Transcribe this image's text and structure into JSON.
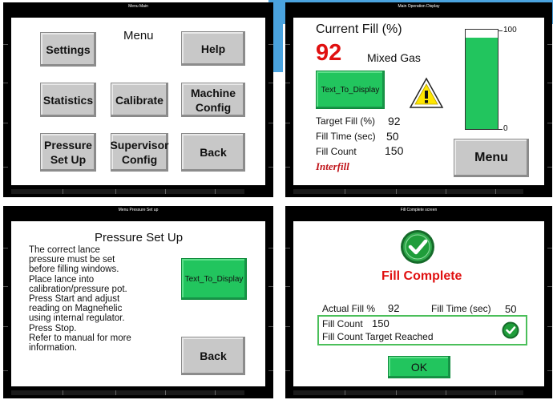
{
  "panels": {
    "menu_main": {
      "title": "Menu Main",
      "heading": "Menu",
      "buttons": {
        "settings": "Settings",
        "help": "Help",
        "statistics": "Statistics",
        "calibrate": "Calibrate",
        "machine_config": "Machine\nConfig",
        "pressure_setup": "Pressure\nSet Up",
        "supervisor_config": "Supervisor\nConfig",
        "back": "Back"
      }
    },
    "main_operation": {
      "title": "Main Operation Display",
      "current_fill_label": "Current Fill (%)",
      "current_fill_value": "92",
      "gas_type": "Mixed Gas",
      "status_button": "Text_To_Display",
      "warning_icon": "warning-triangle",
      "target_fill_label": "Target Fill (%)",
      "target_fill_value": "92",
      "fill_time_label": "Fill Time (sec)",
      "fill_time_value": "50",
      "fill_count_label": "Fill Count",
      "fill_count_value": "150",
      "logo_text": "Interfill",
      "bar_max_label": "100",
      "bar_min_label": "0",
      "bar_fill_percent": 92,
      "menu_button": "Menu"
    },
    "pressure_setup": {
      "title": "Menu Pressure Set up",
      "heading": "Pressure Set Up",
      "instructions": [
        "The correct lance",
        "pressure must be set",
        "before filling windows.",
        "Place lance into",
        "calibration/pressure pot.",
        "Press Start and adjust",
        "reading on Magnehelic",
        "using internal regulator.",
        "Press Stop.",
        "Refer to manual for more",
        "information."
      ],
      "status_button": "Text_To_Display",
      "back_button": "Back"
    },
    "fill_complete": {
      "title": "Fill Complete screen",
      "heading": "Fill Complete",
      "actual_fill_label": "Actual Fill %",
      "actual_fill_value": "92",
      "fill_time_label": "Fill Time (sec)",
      "fill_time_value": "50",
      "fill_count_label": "Fill Count",
      "fill_count_value": "150",
      "target_reached_text": "Fill Count Target Reached",
      "ok_button": "OK"
    }
  },
  "colors": {
    "accent_blue": "#4aa3df",
    "bar_green": "#22c55e",
    "check_green": "#1f9d3a",
    "alert_red": "#e01010",
    "panel_black": "#000000"
  }
}
